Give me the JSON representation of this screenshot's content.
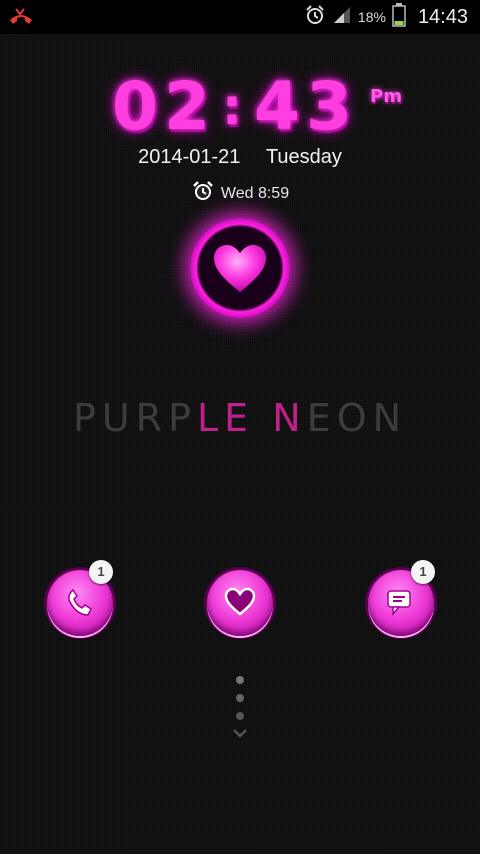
{
  "status_bar": {
    "battery_percent": "18%",
    "time": "14:43",
    "icons": [
      "missed-call-icon",
      "alarm-icon",
      "signal-icon",
      "battery-icon"
    ]
  },
  "clock": {
    "digits": [
      "0",
      "2",
      ":",
      "4",
      "3"
    ],
    "ampm": "Pm"
  },
  "date": {
    "date": "2014-01-21",
    "weekday": "Tuesday"
  },
  "alarm": {
    "label": "Wed 8:59"
  },
  "theme": {
    "title_dim_1": "PURP",
    "title_glow_1": "LE N",
    "title_dim_2": "EON"
  },
  "shortcuts": [
    {
      "name": "phone",
      "badge": "1"
    },
    {
      "name": "heart",
      "badge": ""
    },
    {
      "name": "messages",
      "badge": "1"
    }
  ],
  "colors": {
    "accent": "#ff3ee0",
    "background": "#121212",
    "status_bar": "#000000"
  }
}
